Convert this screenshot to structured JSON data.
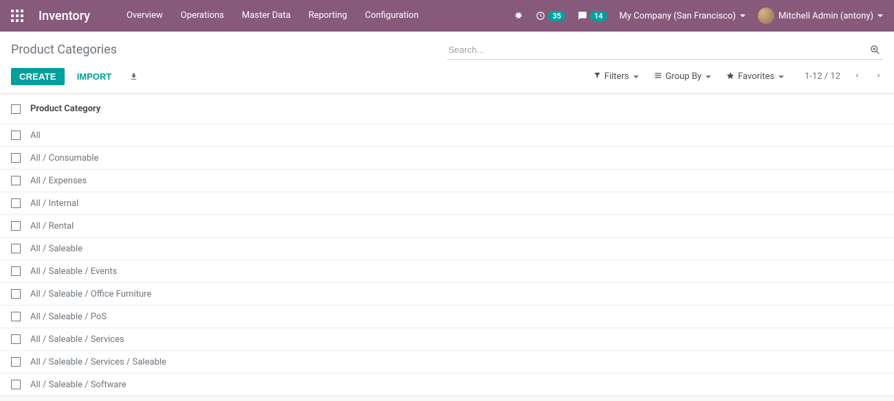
{
  "topnav": {
    "app_title": "Inventory",
    "menu": [
      "Overview",
      "Operations",
      "Master Data",
      "Reporting",
      "Configuration"
    ],
    "activity_badge": "35",
    "messages_badge": "14",
    "company": "My Company (San Francisco)",
    "user": "Mitchell Admin (antony)"
  },
  "breadcrumb": "Product Categories",
  "search": {
    "placeholder": "Search..."
  },
  "buttons": {
    "create": "CREATE",
    "import": "IMPORT"
  },
  "filters": {
    "filters_label": "Filters",
    "groupby_label": "Group By",
    "favorites_label": "Favorites"
  },
  "pager": {
    "text": "1-12 / 12"
  },
  "list": {
    "header": "Product Category",
    "rows": [
      "All",
      "All / Consumable",
      "All / Expenses",
      "All / Internal",
      "All / Rental",
      "All / Saleable",
      "All / Saleable / Events",
      "All / Saleable / Office Furniture",
      "All / Saleable / PoS",
      "All / Saleable / Services",
      "All / Saleable / Services / Saleable",
      "All / Saleable / Software"
    ]
  }
}
